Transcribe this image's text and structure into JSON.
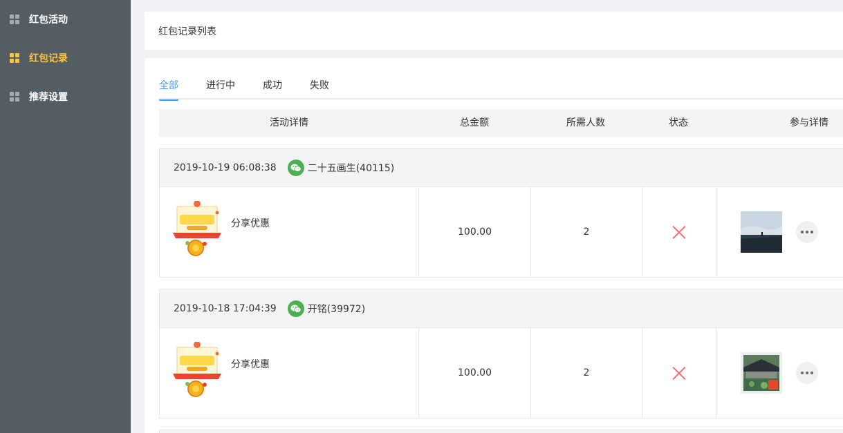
{
  "sidebar": {
    "items": [
      {
        "label": "红包活动",
        "icon": "grid-icon",
        "active": false
      },
      {
        "label": "红包记录",
        "icon": "grid-icon",
        "active": true
      },
      {
        "label": "推荐设置",
        "icon": "grid-icon",
        "active": false
      }
    ]
  },
  "header": {
    "title": "红包记录列表"
  },
  "tabs": [
    {
      "label": "全部",
      "active": true
    },
    {
      "label": "进行中",
      "active": false
    },
    {
      "label": "成功",
      "active": false
    },
    {
      "label": "失败",
      "active": false
    }
  ],
  "table": {
    "columns": [
      "活动详情",
      "总金额",
      "所需人数",
      "状态",
      "参与详情"
    ]
  },
  "orders": [
    {
      "time": "2019-10-19 06:08:38",
      "user": "二十五画生(40115)",
      "platform_icon": "wechat-icon",
      "activity_name": "分享优惠",
      "amount": "100.00",
      "required": "2",
      "status_icon": "fail-icon",
      "avatar": "landscape-photo"
    },
    {
      "time": "2019-10-18 17:04:39",
      "user": "开铭(39972)",
      "platform_icon": "wechat-icon",
      "activity_name": "分享优惠",
      "amount": "100.00",
      "required": "2",
      "status_icon": "fail-icon",
      "avatar": "garden-photo"
    }
  ],
  "colors": {
    "sidebar_bg": "#545c64",
    "sidebar_active": "#ffc53d",
    "accent": "#409eff",
    "fail": "#f56c6c",
    "wechat": "#4caf50"
  }
}
